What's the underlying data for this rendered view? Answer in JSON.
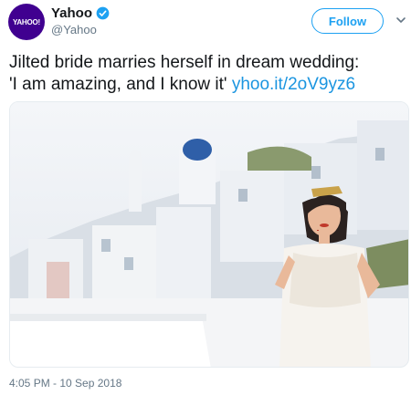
{
  "account": {
    "avatar_text": "YAHOO!",
    "display_name": "Yahoo",
    "handle": "@Yahoo",
    "verified": true,
    "avatar_color": "#400090"
  },
  "actions": {
    "follow_label": "Follow"
  },
  "tweet": {
    "line1": "Jilted bride marries herself in dream wedding:",
    "line2_text": "'I am amazing, and I know it'",
    "link": "yhoo.it/2oV9yz6",
    "timestamp": "4:05 PM - 10 Sep 2018"
  },
  "media": {
    "description_icon": "photo-image"
  },
  "colors": {
    "link": "#1b95e0",
    "follow": "#1da1f2",
    "muted": "#657786",
    "dome": "#2f5fa8"
  }
}
